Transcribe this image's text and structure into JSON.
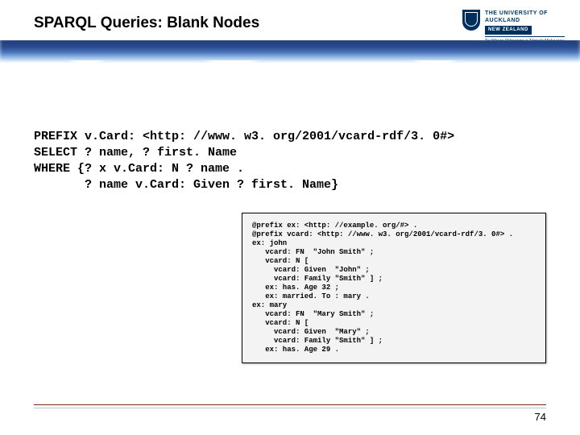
{
  "header": {
    "title": "SPARQL Queries: Blank Nodes",
    "logo": {
      "line1": "THE UNIVERSITY OF",
      "line2": "AUCKLAND",
      "nz": "NEW ZEALAND",
      "maori": "Te Whare Wānanga o Tāmaki Makaurau"
    }
  },
  "query": "PREFIX v.Card: <http: //www. w3. org/2001/vcard-rdf/3. 0#>\nSELECT ? name, ? first. Name\nWHERE {? x v.Card: N ? name .\n       ? name v.Card: Given ? first. Name}",
  "data_block": "@prefix ex: <http: //example. org/#> .\n@prefix vcard: <http: //www. w3. org/2001/vcard-rdf/3. 0#> .\nex: john\n   vcard: FN  \"John Smith\" ;\n   vcard: N [\n     vcard: Given  \"John\" ;\n     vcard: Family \"Smith\" ] ;\n   ex: has. Age 32 ;\n   ex: married. To : mary .\nex: mary\n   vcard: FN  \"Mary Smith\" ;\n   vcard: N [\n     vcard: Given  \"Mary\" ;\n     vcard: Family \"Smith\" ] ;\n   ex: has. Age 29 .",
  "footer": {
    "pagenum": "74"
  }
}
